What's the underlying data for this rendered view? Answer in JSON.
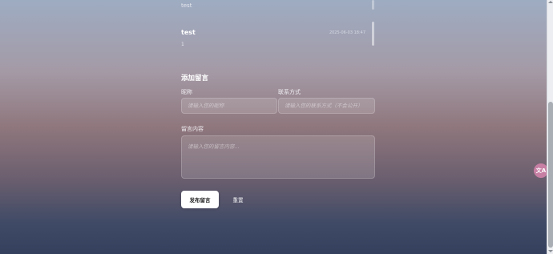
{
  "messages": {
    "previous_text": "test",
    "latest": {
      "name": "test",
      "time": "2025-06-03 18:47",
      "content": "1"
    }
  },
  "form": {
    "title": "添加留言",
    "nickname_label": "昵称",
    "nickname_placeholder": "请输入您的昵称",
    "contact_label": "联系方式",
    "contact_placeholder": "请输入您的联系方式（不会公开）",
    "content_label": "留言内容",
    "content_placeholder": "请输入您的留言内容...",
    "submit_label": "发布留言",
    "reset_label": "重置"
  },
  "floating": {
    "icon": "translate-icon",
    "glyph": "文A"
  }
}
